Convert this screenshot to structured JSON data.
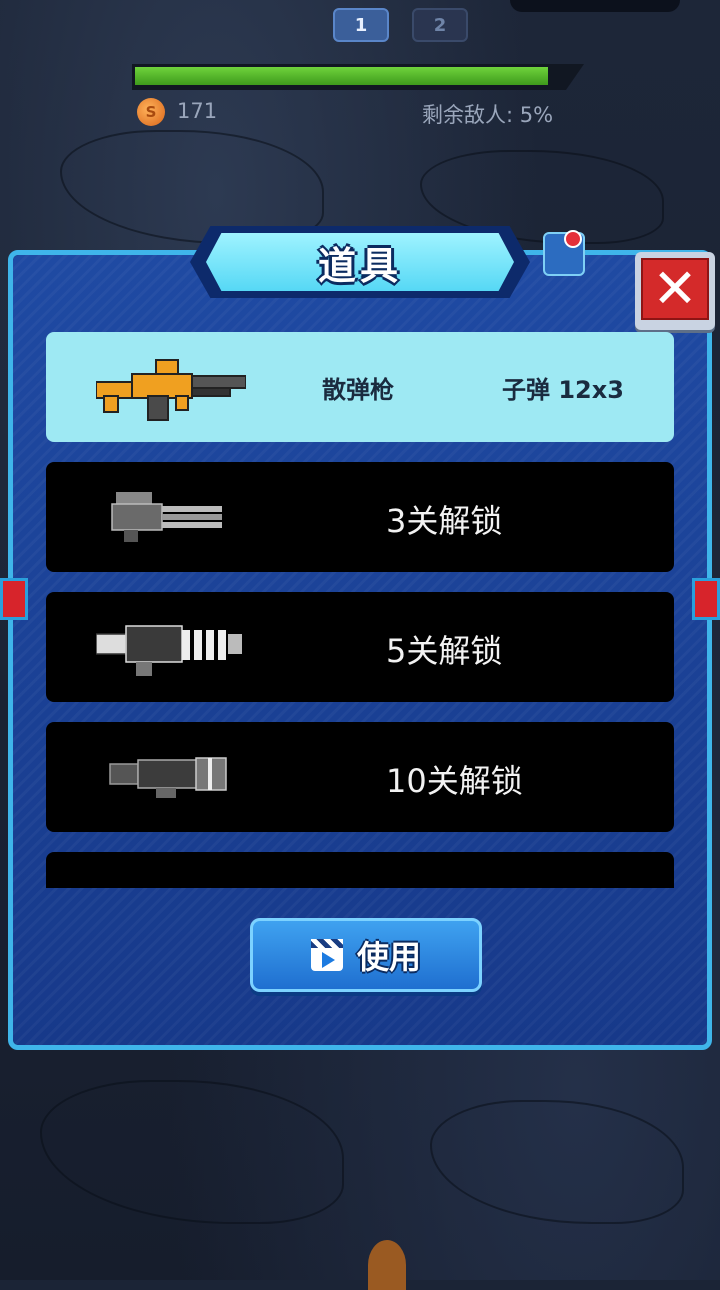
{
  "hud": {
    "stages": [
      "1",
      "2"
    ],
    "hp_fraction": 0.94,
    "coin_icon": "coin-icon",
    "coin_letter": "S",
    "coins": "171",
    "enemies_label": "剩余敌人: 5%"
  },
  "dialog": {
    "title": "道具",
    "close_icon": "close-x-icon",
    "close_glyph": "✕",
    "items": [
      {
        "name": "散弹枪",
        "ammo": "子弹  12x3",
        "icon": "shotgun-icon",
        "selected": true
      },
      {
        "lock_text": "3关解锁",
        "icon": "minigun-icon"
      },
      {
        "lock_text": "5关解锁",
        "icon": "heavy-gatling-icon"
      },
      {
        "lock_text": "10关解锁",
        "icon": "rocket-launcher-icon"
      },
      {
        "icon": "partial-weapon-icon"
      }
    ],
    "use_button": {
      "label": "使用",
      "icon": "video-ad-icon"
    }
  },
  "colors": {
    "panel": "#1b3f8f",
    "panel_border": "#3fb5ea",
    "selected_row": "#9ee9f3",
    "locked_row": "#000000",
    "hp_bar": "#6fd33c",
    "close_button": "#d42a2a"
  }
}
